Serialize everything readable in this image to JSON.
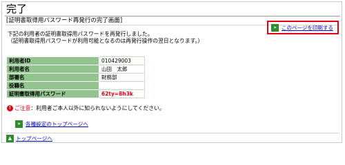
{
  "page": {
    "title": "完了",
    "subtitle": "[証明書取得用パスワード再発行の完了画面]"
  },
  "print_link": {
    "label": "このページを印刷する",
    "icon": "double-arrow-right-icon"
  },
  "notices": [
    "下記の利用者の証明書取得用パスワードを再発行しました。",
    "（証明書取得用パスワードが利用可能となるのは再発行操作の翌日となります。）"
  ],
  "user_table": [
    {
      "label": "利用者ID",
      "value": "010429003"
    },
    {
      "label": "利用者名",
      "value": "山田　太郎"
    },
    {
      "label": "部署名",
      "value": "財務部"
    },
    {
      "label": "役職名",
      "value": ""
    },
    {
      "label": "証明書取得用パスワード",
      "value": "62ty=8h3k"
    }
  ],
  "caution": {
    "label": "ご注意",
    "text": "：利用者ご本人以外に知られないようにしてください。"
  },
  "settings_link": {
    "label": "各種設定のトップページへ"
  },
  "top_link": {
    "label": "トップページへ"
  },
  "colors": {
    "table_label_bg": "#92c48e",
    "print_border": "#e60012",
    "link": "#0000cc",
    "icon_green": "#2e8b2e",
    "password": "#e60012"
  }
}
